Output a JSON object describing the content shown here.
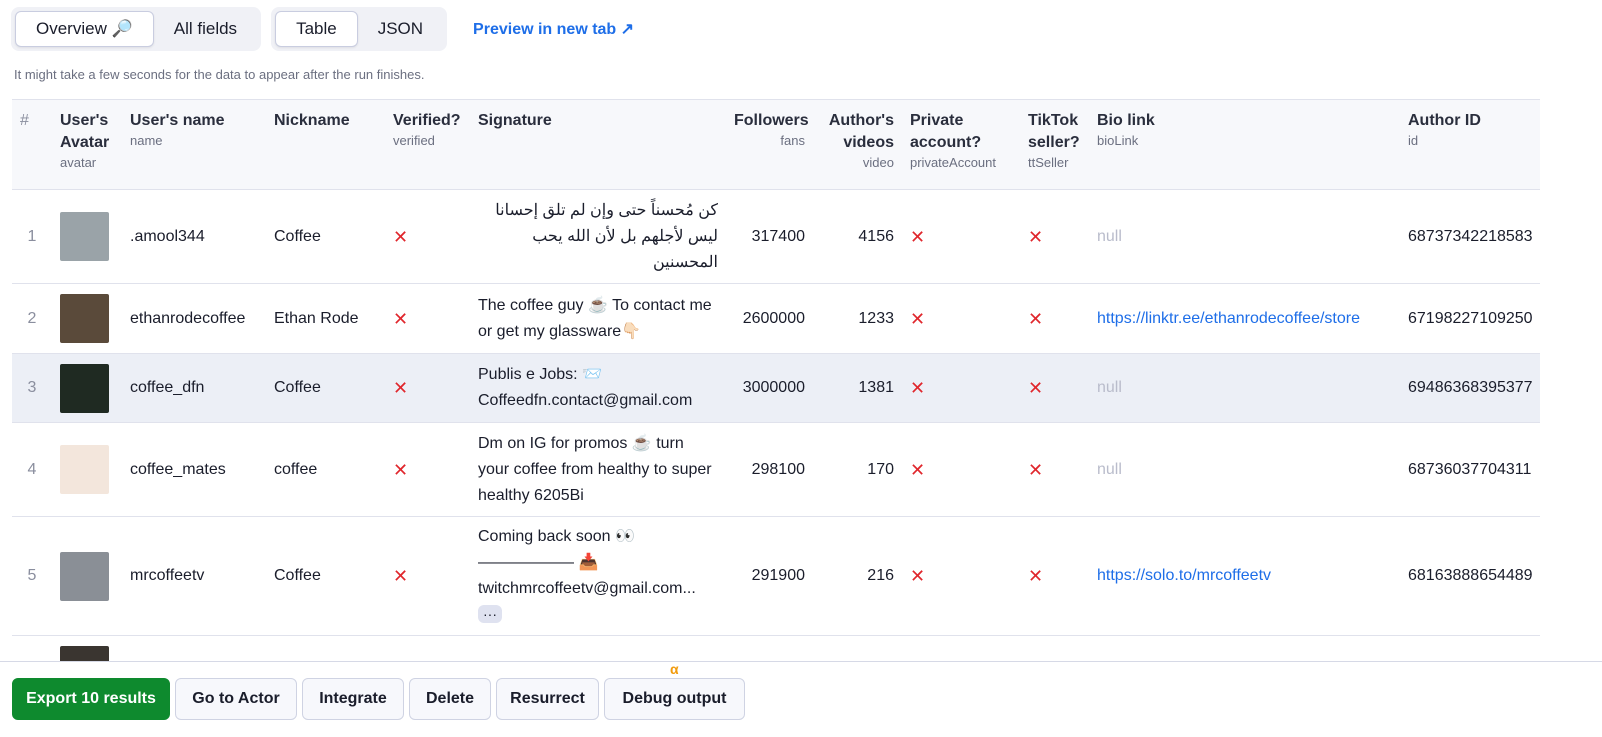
{
  "tabs": {
    "view": [
      {
        "label": "Overview 🔎",
        "active": true
      },
      {
        "label": "All fields",
        "active": false
      }
    ],
    "format": [
      {
        "label": "Table",
        "active": true
      },
      {
        "label": "JSON",
        "active": false
      }
    ],
    "preview": "Preview in new tab ↗"
  },
  "hint": "It might take a few seconds for the data to appear after the run finishes.",
  "columns": [
    {
      "title": "#",
      "key": ""
    },
    {
      "title": "User's Avatar",
      "key": "avatar"
    },
    {
      "title": "User's name",
      "key": "name"
    },
    {
      "title": "Nickname",
      "key": ""
    },
    {
      "title": "Verified?",
      "key": "verified"
    },
    {
      "title": "Signature",
      "key": ""
    },
    {
      "title": "Followers",
      "key": "fans"
    },
    {
      "title": "Author's videos",
      "key": "video"
    },
    {
      "title": "Private account?",
      "key": "privateAccount"
    },
    {
      "title": "TikTok seller?",
      "key": "ttSeller"
    },
    {
      "title": "Bio link",
      "key": "bioLink"
    },
    {
      "title": "Author ID",
      "key": "id"
    }
  ],
  "rows": [
    {
      "n": "1",
      "name": ".amool344",
      "nickname": "Coffee",
      "verified": "✕",
      "signature": "كن مُحسناً حتى وإن لم تلق إحسانا ليس لأجلهم بل لأن الله يحب المحسنين",
      "fans": "317400",
      "video": "4156",
      "private": "✕",
      "seller": "✕",
      "bio": "null",
      "id": "68737342218583",
      "avatar": "#9aa3a8"
    },
    {
      "n": "2",
      "name": "ethanrodecoffee",
      "nickname": "Ethan Rode",
      "verified": "✕",
      "signature": "The coffee guy ☕ To contact me or get my glassware👇🏻",
      "fans": "2600000",
      "video": "1233",
      "private": "✕",
      "seller": "✕",
      "bio": "https://linktr.ee/ethanrodecoffee/store",
      "id": "67198227109250",
      "avatar": "#5a4a3a"
    },
    {
      "n": "3",
      "name": "coffee_dfn",
      "nickname": "Coffee",
      "verified": "✕",
      "signature": "Publis e Jobs: 📨 Coffeedfn.contact@gmail.com",
      "fans": "3000000",
      "video": "1381",
      "private": "✕",
      "seller": "✕",
      "bio": "null",
      "id": "69486368395377",
      "avatar": "#1f2a22"
    },
    {
      "n": "4",
      "name": "coffee_mates",
      "nickname": "coffee",
      "verified": "✕",
      "signature": "Dm on IG for promos ☕ turn your coffee from healthy to super healthy 6205Bi",
      "fans": "298100",
      "video": "170",
      "private": "✕",
      "seller": "✕",
      "bio": "null",
      "id": "68736037704311",
      "avatar": "#f3e6dc"
    },
    {
      "n": "5",
      "name": "mrcoffeetv",
      "nickname": "Coffee",
      "verified": "✕",
      "signature": "Coming back soon 👀 —————— 📥 twitchmrcoffeetv@gmail.com...",
      "fans": "291900",
      "video": "216",
      "private": "✕",
      "seller": "✕",
      "bio": "https://solo.to/mrcoffeetv",
      "id": "68163888654489",
      "avatar": "#8a8f96",
      "more": "···"
    },
    {
      "n": "",
      "name": "",
      "nickname": "",
      "verified": "",
      "signature": "",
      "fans": "",
      "video": "",
      "private": "",
      "seller": "",
      "bio": "",
      "id": "",
      "avatar": "#3a3530"
    }
  ],
  "footer": {
    "export": "Export 10 results",
    "goto": "Go to Actor",
    "integrate": "Integrate",
    "delete": "Delete",
    "resurrect": "Resurrect",
    "debug": "Debug output",
    "alpha": "α"
  }
}
